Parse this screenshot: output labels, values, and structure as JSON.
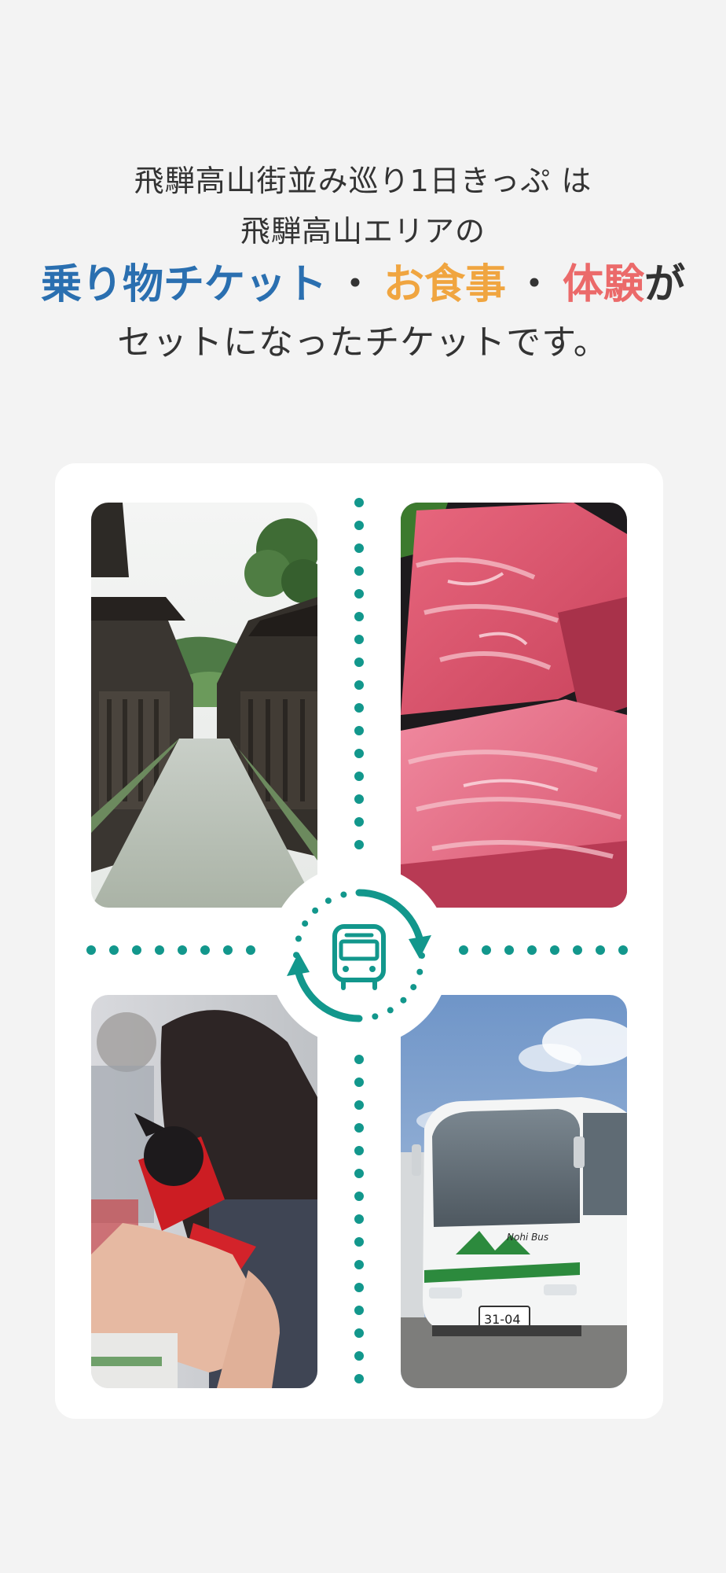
{
  "intro": {
    "line1": "飛騨高山街並み巡り1日きっぷ は",
    "line2": "飛騨高山エリアの",
    "highlights": [
      {
        "text": "乗り物チケット",
        "color": "#2a6fb0"
      },
      {
        "text": "お食事",
        "color": "#f0a540"
      },
      {
        "text": "体験",
        "color": "#eb6a6a"
      }
    ],
    "separator": "・",
    "highlight_suffix": "が",
    "line4": "セットになったチケットです。"
  },
  "colors": {
    "background": "#f3f3f3",
    "card": "#ffffff",
    "accent_teal": "#12978c",
    "text": "#333333"
  },
  "visual": {
    "photos": [
      "takayama-old-town-street",
      "hida-beef",
      "sarubobo-craft-experience",
      "nohi-bus"
    ],
    "hub_icon": "bus-icon",
    "bus_sign": "Nohi Bus",
    "bus_plate": "31-04"
  }
}
